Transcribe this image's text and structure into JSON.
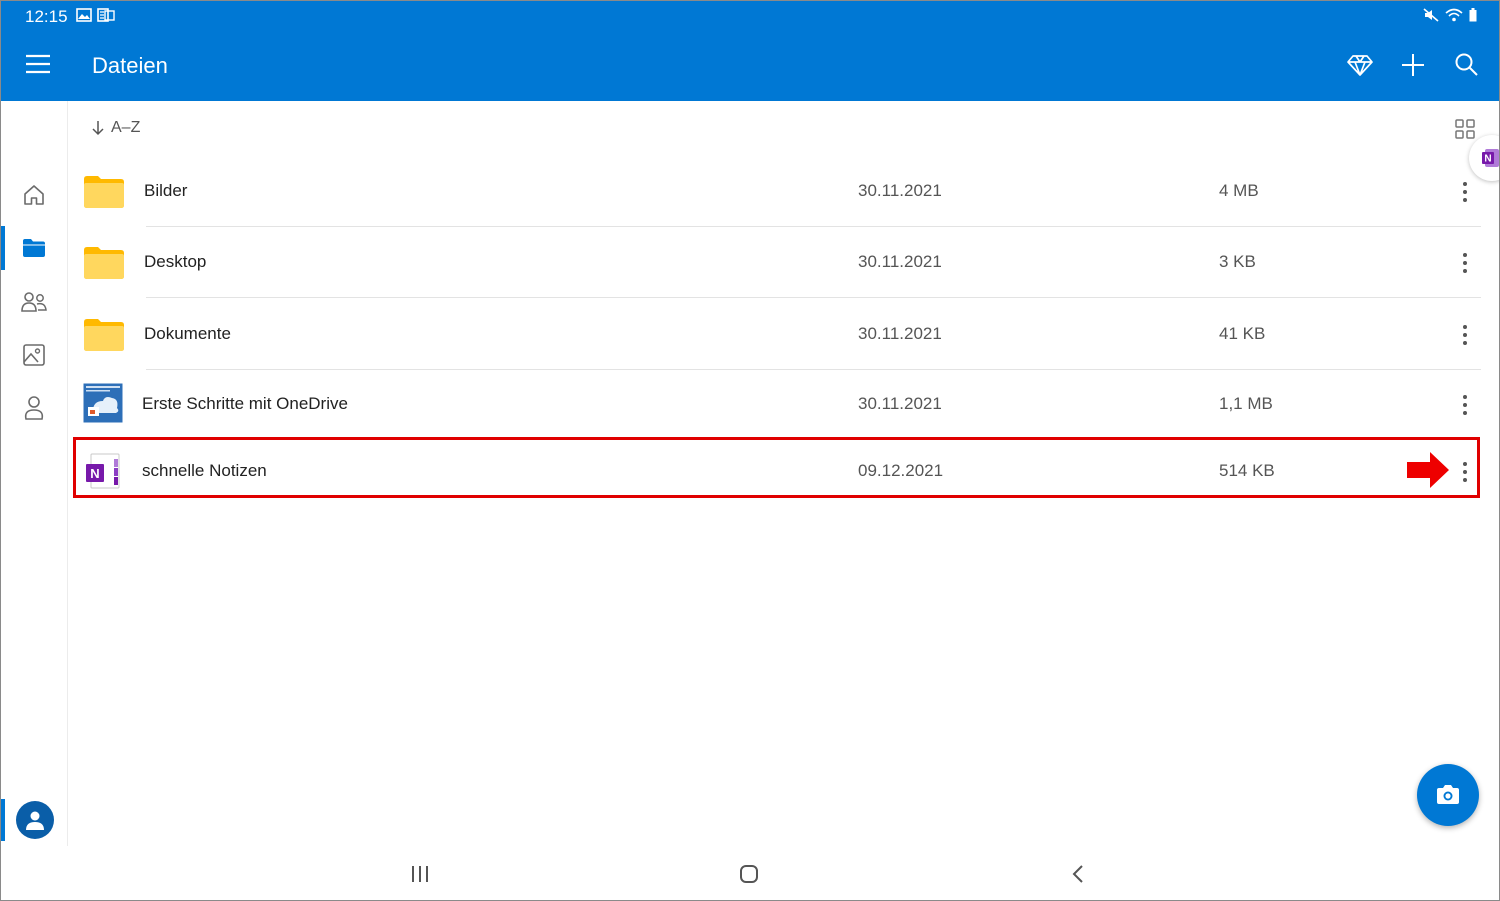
{
  "status_bar": {
    "time": "12:15"
  },
  "app_bar": {
    "title": "Dateien"
  },
  "sort": {
    "label": "A–Z"
  },
  "files": [
    {
      "name": "Bilder",
      "date": "30.11.2021",
      "size": "4 MB",
      "type": "folder"
    },
    {
      "name": "Desktop",
      "date": "30.11.2021",
      "size": "3 KB",
      "type": "folder"
    },
    {
      "name": "Dokumente",
      "date": "30.11.2021",
      "size": "41 KB",
      "type": "folder"
    },
    {
      "name": "Erste Schritte mit OneDrive",
      "date": "30.11.2021",
      "size": "1,1 MB",
      "type": "pdf-thumbnail"
    },
    {
      "name": "schnelle Notizen",
      "date": "09.12.2021",
      "size": "514 KB",
      "type": "onenote"
    }
  ],
  "rail": {
    "items": [
      {
        "icon": "home-icon"
      },
      {
        "icon": "folder-icon",
        "active": true
      },
      {
        "icon": "people-icon"
      },
      {
        "icon": "photos-icon"
      },
      {
        "icon": "person-icon"
      }
    ]
  },
  "colors": {
    "accent": "#0078d4",
    "folder": "#ffc83d",
    "onenote": "#7719aa",
    "highlight": "#e00000"
  }
}
